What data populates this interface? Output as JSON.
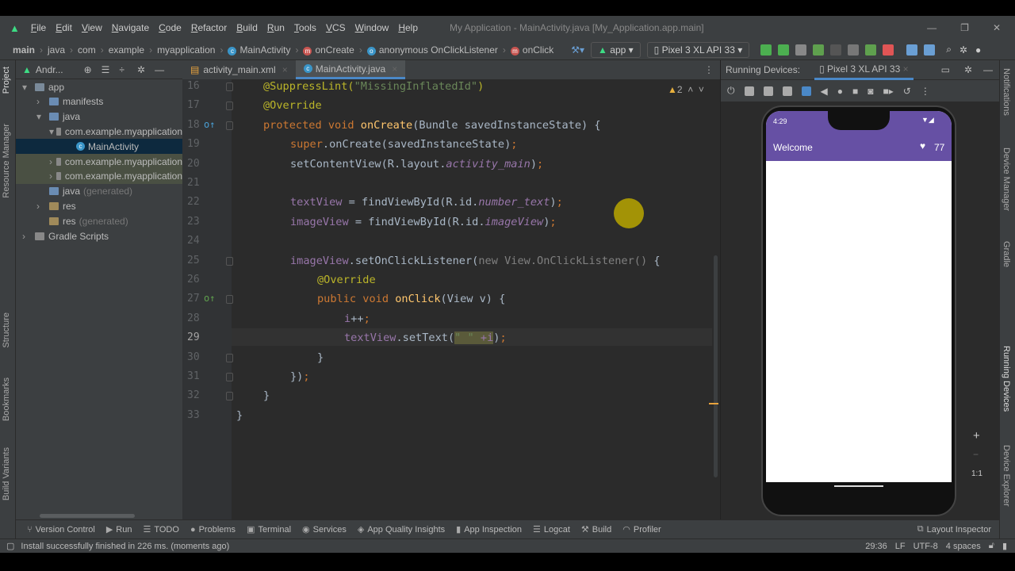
{
  "window": {
    "title": "My Application - MainActivity.java [My_Application.app.main]",
    "minimize": "—",
    "restore": "❐",
    "close": "✕"
  },
  "menu": [
    "File",
    "Edit",
    "View",
    "Navigate",
    "Code",
    "Refactor",
    "Build",
    "Run",
    "Tools",
    "VCS",
    "Window",
    "Help"
  ],
  "breadcrumb": [
    "main",
    "java",
    "com",
    "example",
    "myapplication",
    "MainActivity",
    "onCreate",
    "anonymous OnClickListener",
    "onClick"
  ],
  "toolbar": {
    "config": "app",
    "device": "Pixel 3 XL API 33"
  },
  "left_strip": [
    "Project",
    "Resource Manager",
    "Structure",
    "Bookmarks",
    "Build Variants"
  ],
  "right_strip": [
    "Notifications",
    "Device Manager",
    "Gradle",
    "Running Devices",
    "Device Explorer"
  ],
  "project": {
    "title": "Andr...",
    "tree": [
      {
        "label": "app",
        "muted": ""
      },
      {
        "label": "manifests",
        "muted": ""
      },
      {
        "label": "java",
        "muted": ""
      },
      {
        "label": "com.example.myapplication",
        "muted": ""
      },
      {
        "label": "MainActivity",
        "muted": ""
      },
      {
        "label": "com.example.myapplication",
        "muted": ""
      },
      {
        "label": "com.example.myapplication",
        "muted": ""
      },
      {
        "label": "java",
        "muted": "(generated)"
      },
      {
        "label": "res",
        "muted": ""
      },
      {
        "label": "res",
        "muted": "(generated)"
      },
      {
        "label": "Gradle Scripts",
        "muted": ""
      }
    ]
  },
  "tabs": [
    {
      "label": "activity_main.xml"
    },
    {
      "label": "MainActivity.java"
    }
  ],
  "editor": {
    "warnings": "2",
    "lines": [
      {
        "n": "16",
        "indent": 1,
        "t": [
          [
            "@SuppressLint(",
            "a"
          ],
          [
            "\"MissingInflatedId\"",
            "s"
          ],
          [
            ")",
            "a"
          ]
        ]
      },
      {
        "n": "17",
        "indent": 1,
        "t": [
          [
            "@Override",
            "a"
          ]
        ]
      },
      {
        "n": "18",
        "indent": 1,
        "t": [
          [
            "protected void ",
            "k"
          ],
          [
            "onCreate",
            "f"
          ],
          [
            "(Bundle savedInstanceState) {",
            "d"
          ]
        ]
      },
      {
        "n": "19",
        "indent": 2,
        "t": [
          [
            "super",
            "k"
          ],
          [
            ".onCreate(savedInstanceState)",
            "d"
          ],
          [
            ";",
            "k"
          ]
        ]
      },
      {
        "n": "20",
        "indent": 2,
        "t": [
          [
            "setContentView(R.layout.",
            "d"
          ],
          [
            "activity_main",
            "vi"
          ],
          [
            ")",
            "d"
          ],
          [
            ";",
            "k"
          ]
        ]
      },
      {
        "n": "21",
        "indent": 2,
        "t": []
      },
      {
        "n": "22",
        "indent": 2,
        "t": [
          [
            "textView",
            "v"
          ],
          [
            " = findViewById(R.id.",
            "d"
          ],
          [
            "number_text",
            "vi"
          ],
          [
            ")",
            "d"
          ],
          [
            ";",
            "k"
          ]
        ]
      },
      {
        "n": "23",
        "indent": 2,
        "t": [
          [
            "imageView",
            "v"
          ],
          [
            " = findViewById(R.id.",
            "d"
          ],
          [
            "imageView",
            "vi"
          ],
          [
            ")",
            "d"
          ],
          [
            ";",
            "k"
          ]
        ]
      },
      {
        "n": "24",
        "indent": 2,
        "t": []
      },
      {
        "n": "25",
        "indent": 2,
        "t": [
          [
            "imageView",
            "v"
          ],
          [
            ".setOnClickListener(",
            "d"
          ],
          [
            "new View.OnClickListener() ",
            "g"
          ],
          [
            "{",
            "d"
          ]
        ]
      },
      {
        "n": "26",
        "indent": 3,
        "t": [
          [
            "@Override",
            "a"
          ]
        ]
      },
      {
        "n": "27",
        "indent": 3,
        "t": [
          [
            "public void ",
            "k"
          ],
          [
            "onClick",
            "f"
          ],
          [
            "(View v) {",
            "d"
          ]
        ]
      },
      {
        "n": "28",
        "indent": 4,
        "t": [
          [
            "i",
            "v"
          ],
          [
            "++",
            "d"
          ],
          [
            ";",
            "k"
          ]
        ]
      },
      {
        "n": "29",
        "indent": 4,
        "t": [
          [
            "textView",
            "v"
          ],
          [
            ".setText(",
            "d"
          ],
          [
            "\" \" ",
            "hs"
          ],
          [
            "+i",
            "hv"
          ],
          [
            ")",
            "d"
          ],
          [
            ";",
            "k"
          ]
        ]
      },
      {
        "n": "30",
        "indent": 3,
        "t": [
          [
            "}",
            "d"
          ]
        ]
      },
      {
        "n": "31",
        "indent": 2,
        "t": [
          [
            "})",
            "d"
          ],
          [
            ";",
            "k"
          ]
        ]
      },
      {
        "n": "32",
        "indent": 1,
        "t": [
          [
            "}",
            "d"
          ]
        ]
      },
      {
        "n": "33",
        "indent": 0,
        "t": [
          [
            "}",
            "d"
          ]
        ]
      }
    ]
  },
  "running": {
    "label": "Running Devices:",
    "device_tab": "Pixel 3 XL API 33"
  },
  "phone": {
    "time": "4:29",
    "app_title": "Welcome",
    "count": "77",
    "zoom_in": "+",
    "zoom_out": "−",
    "one_to_one": "1:1"
  },
  "bottom_tools": [
    "Version Control",
    "Run",
    "TODO",
    "Problems",
    "Terminal",
    "Services",
    "App Quality Insights",
    "App Inspection",
    "Logcat",
    "Build",
    "Profiler"
  ],
  "layout_inspector": "Layout Inspector",
  "status": {
    "message": "Install successfully finished in 226 ms. (moments ago)",
    "position": "29:36",
    "line_sep": "LF",
    "encoding": "UTF-8",
    "indent": "4 spaces"
  },
  "colors": {
    "accent": "#6650a4",
    "editor_bg": "#2b2b2b",
    "panel_bg": "#3c3f41"
  }
}
